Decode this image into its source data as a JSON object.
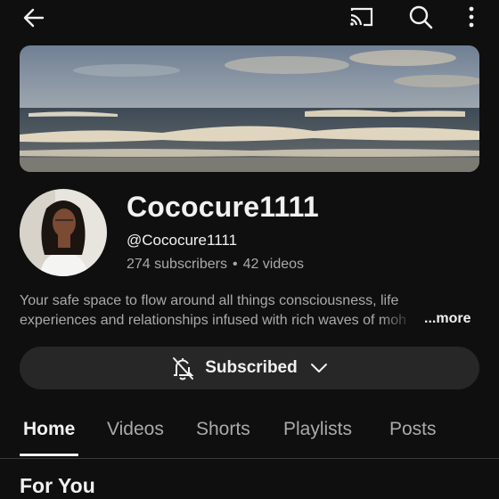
{
  "topbar": {
    "back_icon": "arrow-left-icon",
    "cast_icon": "cast-icon",
    "search_icon": "search-icon",
    "menu_icon": "more-vertical-icon"
  },
  "channel": {
    "name": "Cococure1111",
    "handle": "@Cococure1111",
    "subscribers": "274 subscribers",
    "separator": "•",
    "videos": "42 videos",
    "description_line1": "Your safe space to flow around all things consciousness, life",
    "description_line2": "experiences and relationships infused with rich waves of moh",
    "more_label": "...more"
  },
  "subscribe_button": {
    "label": "Subscribed",
    "bell_icon": "bell-off-icon",
    "chevron_icon": "chevron-down-icon"
  },
  "tabs": [
    {
      "label": "Home",
      "active": true
    },
    {
      "label": "Videos",
      "active": false
    },
    {
      "label": "Shorts",
      "active": false
    },
    {
      "label": "Playlists",
      "active": false
    },
    {
      "label": "Posts",
      "active": false
    }
  ],
  "section": {
    "title": "For You"
  },
  "colors": {
    "background": "#0f0f0f",
    "text_primary": "#f1f1f1",
    "text_secondary": "#aaaaaa",
    "button_bg": "#272727"
  }
}
